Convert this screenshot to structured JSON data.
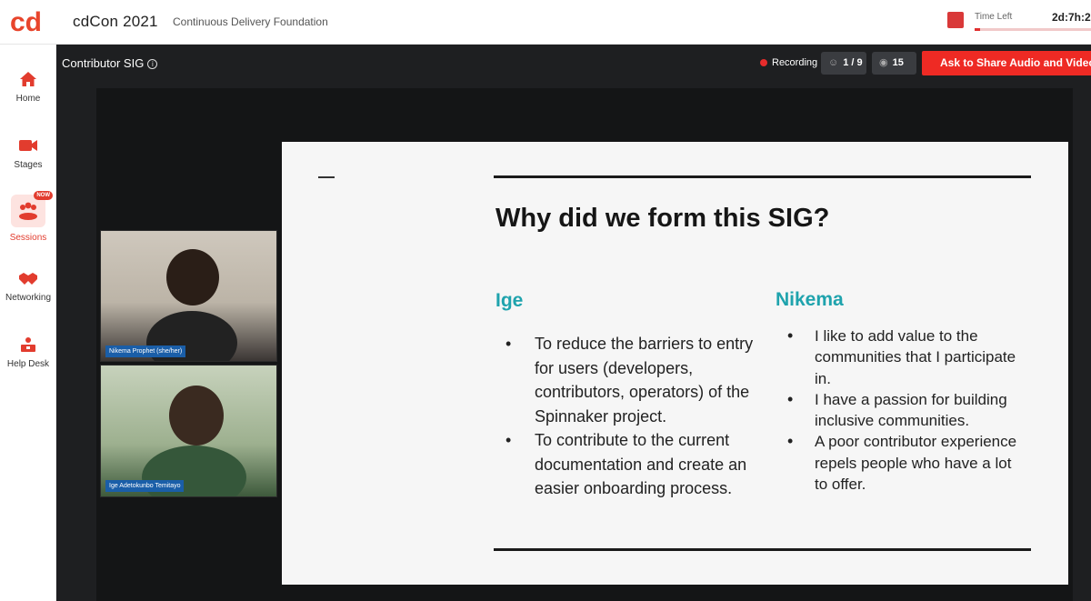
{
  "app": {
    "title": "cdCon 2021",
    "organization": "Continuous Delivery Foundation",
    "logo_text": "cd",
    "time_left_label": "Time Left",
    "time_left_value": "2d:7h:2"
  },
  "sidebar": {
    "items": [
      {
        "label": "Home",
        "icon": "home-icon"
      },
      {
        "label": "Stages",
        "icon": "video-camera-icon"
      },
      {
        "label": "Sessions",
        "icon": "sessions-icon",
        "badge": "NOW",
        "active": true
      },
      {
        "label": "Networking",
        "icon": "handshake-icon"
      },
      {
        "label": "Help Desk",
        "icon": "help-desk-icon"
      }
    ]
  },
  "stage": {
    "title": "Contributor SIG",
    "recording_label": "Recording",
    "participants": "1 / 9",
    "viewers": "15",
    "share_button": "Ask to Share Audio and Video"
  },
  "cameras": [
    {
      "name": "Nikema Prophet (she/her)"
    },
    {
      "name": "Ige Adetokunbo Temitayo"
    }
  ],
  "slide": {
    "title": "Why did we form this SIG?",
    "left_heading": "Ige",
    "left_bullets": [
      "To reduce the barriers to entry for users (developers, contributors, operators) of the Spinnaker project.",
      "To contribute to the current documentation and create an easier onboarding process."
    ],
    "right_heading": "Nikema",
    "right_bullets": [
      "I like to add value to the communities that I participate in.",
      "I have a passion for building inclusive communities.",
      "A poor contributor experience repels people who have a lot to offer."
    ]
  },
  "colors": {
    "brand": "#e23c2e",
    "accent_teal": "#1fa3ad",
    "stage_bg": "#1e1f21",
    "share_button": "#ee2a24"
  }
}
